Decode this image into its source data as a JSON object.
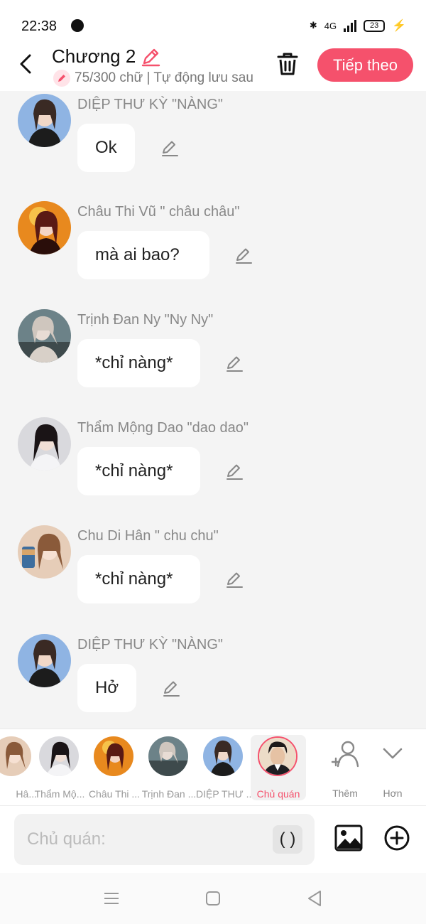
{
  "status_bar": {
    "time": "22:38",
    "network": "4G",
    "battery": "23"
  },
  "header": {
    "title": "Chương 2",
    "subtitle": "75/300 chữ | Tự động lưu sau",
    "next_label": "Tiếp theo",
    "colors": {
      "accent": "#f5516c"
    }
  },
  "messages": [
    {
      "name": "DIỆP THƯ KỲ \"NÀNG\"",
      "text": "Ok",
      "avatar": "diep-thu-ky"
    },
    {
      "name": "Châu Thi Vũ \" châu châu\"",
      "text": "mà ai bao?",
      "avatar": "chau-thi-vu"
    },
    {
      "name": "Trịnh Đan Ny \"Ny Ny\"",
      "text": "*chỉ nàng*",
      "avatar": "trinh-dan-ny"
    },
    {
      "name": "Thẩm Mộng Dao \"dao dao\"",
      "text": "*chỉ nàng*",
      "avatar": "tham-mong-dao"
    },
    {
      "name": "Chu Di Hân \" chu chu\"",
      "text": "*chỉ nàng*",
      "avatar": "chu-di-han"
    },
    {
      "name": "DIỆP THƯ KỲ \"NÀNG\"",
      "text": "Hở",
      "avatar": "diep-thu-ky"
    }
  ],
  "characters": [
    {
      "label": "Hâ...",
      "avatar": "chu-di-han"
    },
    {
      "label": "Thẩm Mộ...",
      "avatar": "tham-mong-dao"
    },
    {
      "label": "Châu Thi ...",
      "avatar": "chau-thi-vu"
    },
    {
      "label": "Trịnh Đan ...",
      "avatar": "trinh-dan-ny"
    },
    {
      "label": "DIỆP THƯ ...",
      "avatar": "diep-thu-ky"
    },
    {
      "label": "Chủ quán",
      "avatar": "chu-quan",
      "selected": true
    }
  ],
  "actions": {
    "add_label": "Thêm",
    "more_label": "Hơn"
  },
  "input": {
    "placeholder": "Chủ quán:",
    "paren_label": "( )"
  }
}
